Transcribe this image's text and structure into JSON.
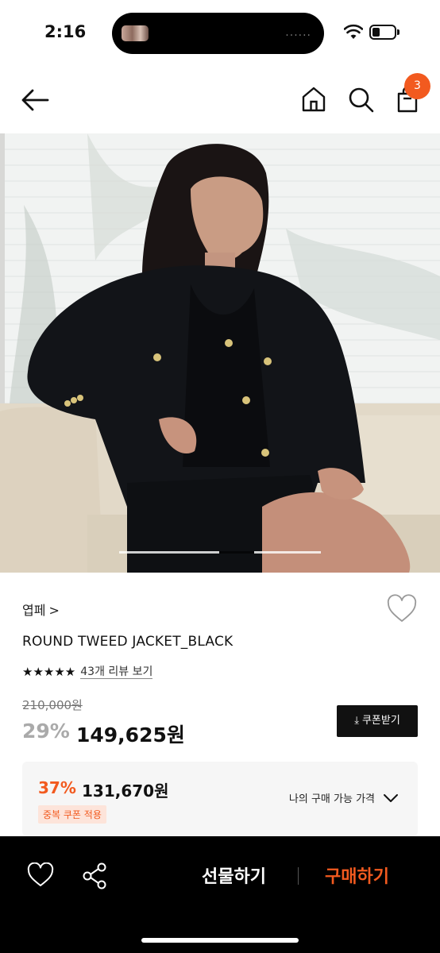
{
  "status_bar": {
    "time": "2:16",
    "island_dots": "......"
  },
  "header": {
    "cart_count": "3"
  },
  "hero": {
    "image_alt": "ROUND TWEED JACKET_BLACK",
    "slide_index": 2,
    "slide_count": 3
  },
  "product": {
    "brand": "엽페",
    "brand_chevron": ">",
    "title": "ROUND TWEED JACKET_BLACK",
    "stars": "★★★★★",
    "rating_value": 5,
    "reviews_link": "43개 리뷰 보기",
    "original_price": "210,000원",
    "discount": "29%",
    "price": "149,625원",
    "coupon_button": "쿠폰받기",
    "coupon_icon": "⤓"
  },
  "my_price": {
    "discount": "37%",
    "price": "131,670원",
    "badge": "중복 쿠폰 적용",
    "toggle_label": "나의 구매 가능 가격"
  },
  "bottom_bar": {
    "gift_label": "선물하기",
    "buy_label": "구매하기"
  },
  "colors": {
    "accent": "#f25a1f",
    "text": "#111111",
    "muted": "#aaaaaa",
    "bar_bg": "#000000"
  }
}
